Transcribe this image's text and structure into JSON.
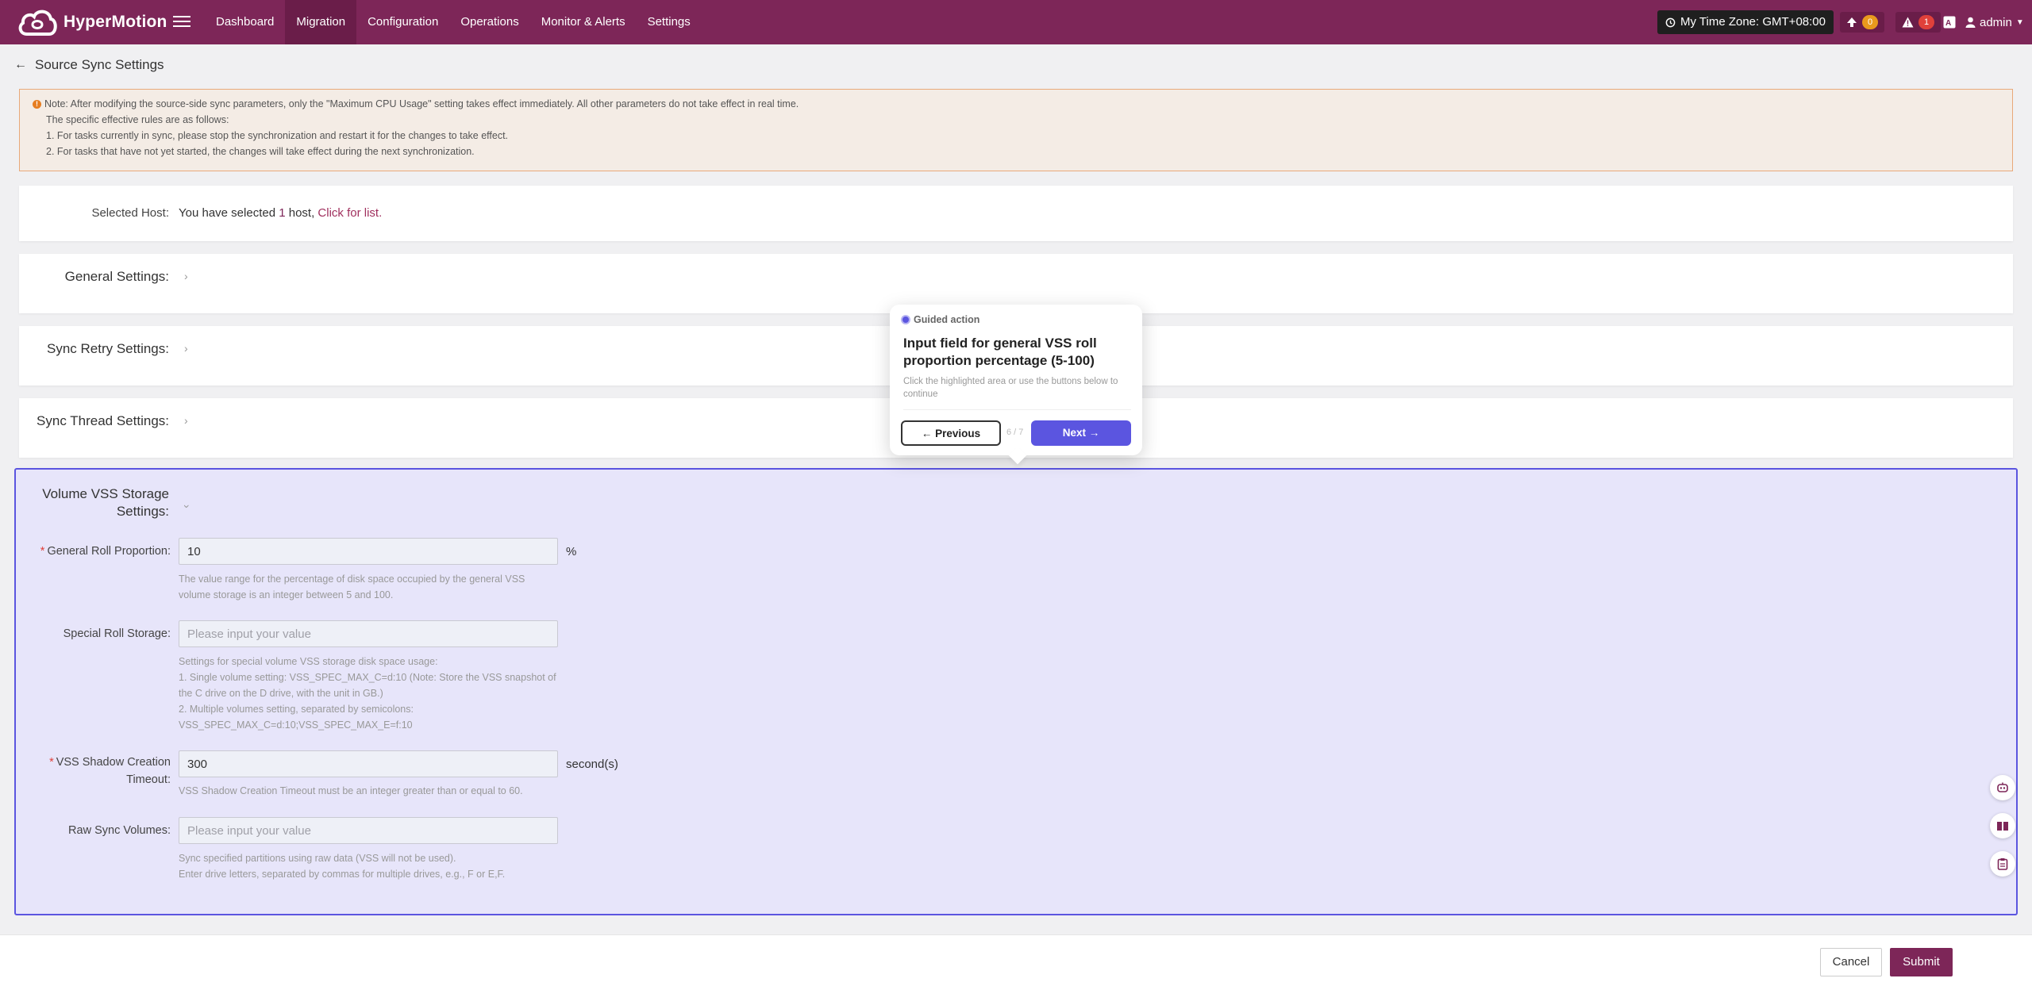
{
  "header": {
    "brand": "HyperMotion",
    "nav": [
      {
        "label": "Dashboard",
        "active": false
      },
      {
        "label": "Migration",
        "active": true
      },
      {
        "label": "Configuration",
        "active": false
      },
      {
        "label": "Operations",
        "active": false
      },
      {
        "label": "Monitor & Alerts",
        "active": false
      },
      {
        "label": "Settings",
        "active": false
      }
    ],
    "timezone": "My Time Zone: GMT+08:00",
    "upload_count": "0",
    "alert_count": "1",
    "user": "admin",
    "colors": {
      "bar": "#7d2658",
      "active": "#6a1d49"
    }
  },
  "page": {
    "title": "Source Sync Settings"
  },
  "notice": {
    "line1": "Note: After modifying the source-side sync parameters, only the \"Maximum CPU Usage\" setting takes effect immediately. All other parameters do not take effect in real time.",
    "line2": "The specific effective rules are as follows:",
    "line3": "1. For tasks currently in sync, please stop the synchronization and restart it for the changes to take effect.",
    "line4": "2. For tasks that have not yet started, the changes will take effect during the next synchronization."
  },
  "host": {
    "label": "Selected Host:",
    "text": "You have selected ",
    "count": "1",
    "text2": " host, ",
    "link": "Click for list."
  },
  "sections": {
    "general": "General Settings:",
    "retry": "Sync Retry Settings:",
    "thread": "Sync Thread Settings:",
    "vss_line1": "Volume VSS Storage",
    "vss_line2": "Settings:"
  },
  "vss": {
    "general_roll": {
      "label": "General Roll Proportion:",
      "value": "10",
      "unit": "%",
      "help1": "The value range for the percentage of disk space occupied by the general VSS",
      "help2": "volume storage is an integer between 5 and 100."
    },
    "special_roll": {
      "label": "Special Roll Storage:",
      "placeholder": "Please input your value",
      "help1": "Settings for special volume VSS storage disk space usage:",
      "help2": "1. Single volume setting: VSS_SPEC_MAX_C=d:10 (Note: Store the VSS snapshot of",
      "help3": "the C drive on the D drive, with the unit in GB.)",
      "help4": "2. Multiple volumes setting, separated by semicolons:",
      "help5": "VSS_SPEC_MAX_C=d:10;VSS_SPEC_MAX_E=f:10"
    },
    "shadow_timeout": {
      "label1": "VSS Shadow Creation",
      "label2": "Timeout:",
      "value": "300",
      "unit": "second(s)",
      "help": "VSS Shadow Creation Timeout must be an integer greater than or equal to 60."
    },
    "raw_sync": {
      "label": "Raw Sync Volumes:",
      "placeholder": "Please input your value",
      "help1": "Sync specified partitions using raw data (VSS will not be used).",
      "help2": "Enter drive letters, separated by commas for multiple drives, e.g., F or E,F."
    }
  },
  "guide": {
    "tag": "Guided action",
    "title": "Input field for general VSS roll proportion percentage (5-100)",
    "subtitle": "Click the highlighted area or use the buttons below to continue",
    "prev": "← Previous",
    "next": "Next →",
    "counter": "6 / 7",
    "accent": "#5b55e0"
  },
  "footer": {
    "cancel": "Cancel",
    "submit": "Submit"
  }
}
